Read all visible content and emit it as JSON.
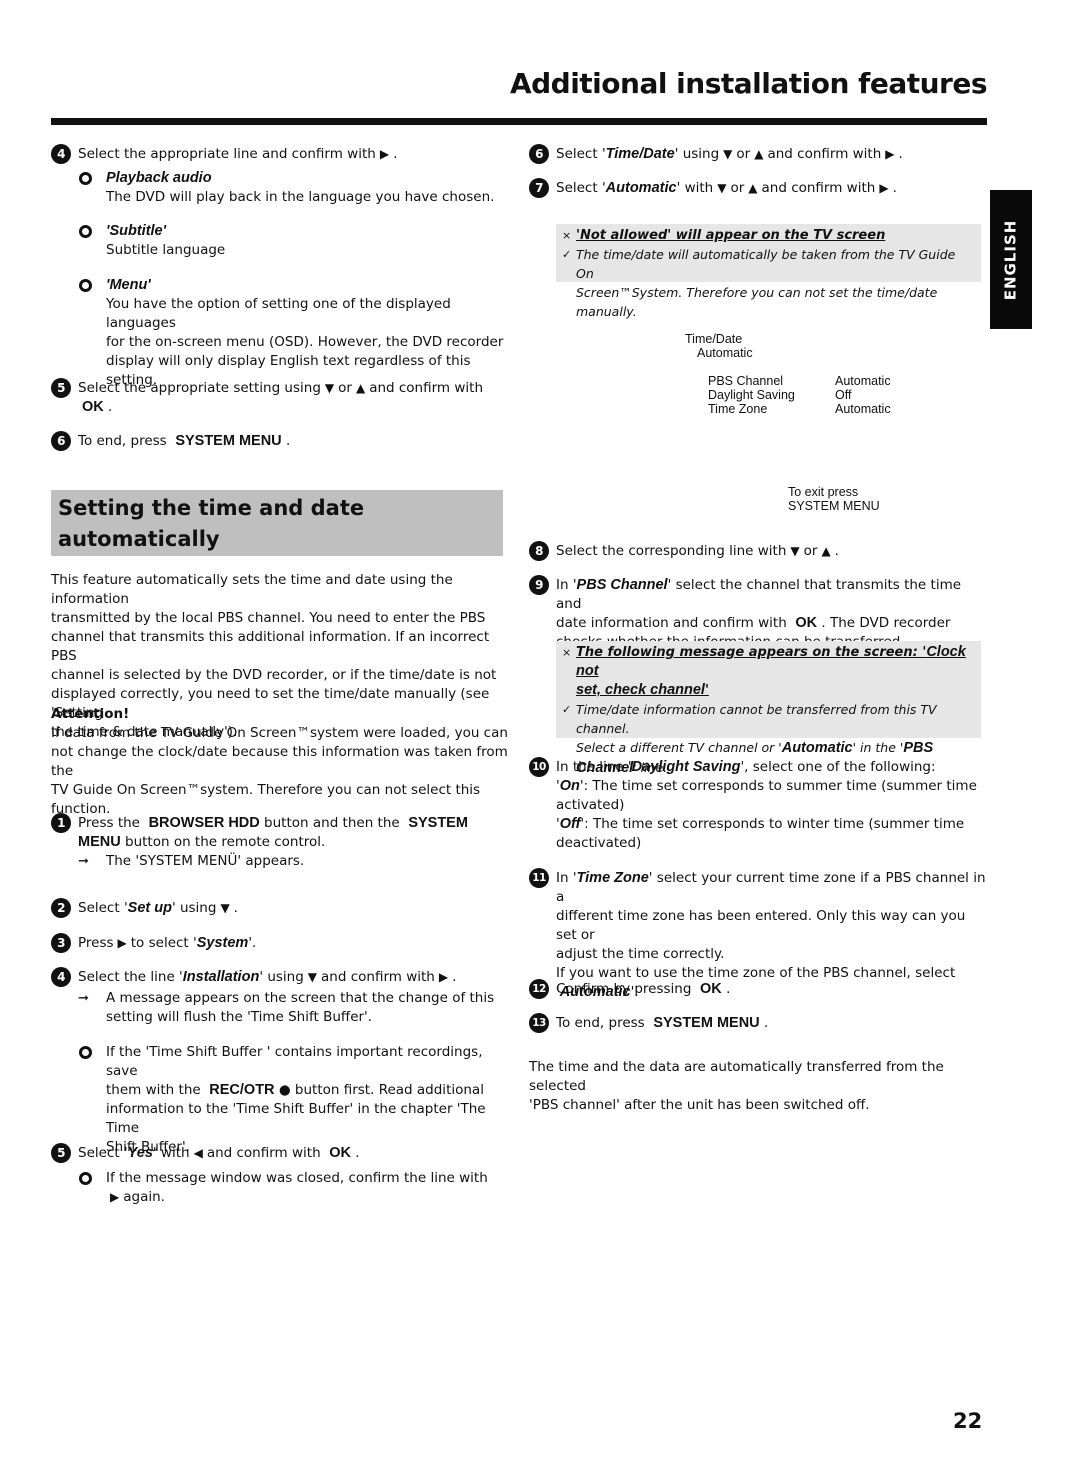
{
  "header": {
    "title": "Additional installation features",
    "language_tab": "ENGLISH",
    "page_number": "22"
  },
  "left_column": {
    "step4_top": {
      "number": "4",
      "text": "Select the appropriate line and confirm with",
      "end": ".",
      "options": [
        {
          "label": "Playback audio",
          "desc": "The DVD will play back in the language you have chosen."
        },
        {
          "label": "'Subtitle'",
          "desc": "Subtitle language"
        },
        {
          "label": "'Menu'",
          "desc_lines": [
            "You have the option of setting one of the displayed languages",
            "for the on-screen menu (OSD). However, the DVD recorder",
            "display will only display English text regardless of this setting."
          ]
        }
      ]
    },
    "step5_top": {
      "number": "5",
      "text_a": "Select the appropriate setting using",
      "or": "or",
      "text_b": "and confirm with",
      "key": "OK",
      "end": "."
    },
    "step6_top": {
      "number": "6",
      "text": "To end, press",
      "key": "SYSTEM MENU",
      "end": "."
    },
    "section_title_lines": [
      "Setting the time and date",
      "automatically"
    ],
    "intro_lines": [
      "This feature automatically sets the time and date using the information",
      "transmitted by the local PBS channel. You need to enter the PBS",
      "channel that transmits this additional information. If an incorrect PBS",
      "channel is selected by the DVD recorder, or if the time/date is not",
      "displayed correctly, you need to set the time/date manually (see 'Setting",
      "the time & date manually')."
    ],
    "attention_label": "Attention!",
    "attention_lines": [
      "If data from the TV Guide On Screen™system were loaded, you can",
      "not change the clock/date because this information was taken from the",
      "TV Guide On Screen™system. Therefore you can not select this",
      "function."
    ],
    "step1": {
      "number": "1",
      "a": "Press the",
      "key1": "BROWSER HDD",
      "b": "button and then the",
      "key2a": "SYSTEM",
      "key2b": "MENU",
      "c": "button on the remote control.",
      "result": "The 'SYSTEM MENÜ' appears."
    },
    "step2": {
      "number": "2",
      "a": "Select '",
      "key": "Set up",
      "b": "' using",
      "end": "."
    },
    "step3": {
      "number": "3",
      "a": "Press",
      "b": "to select '",
      "key": "System",
      "end": "'."
    },
    "step4": {
      "number": "4",
      "a": "Select the line '",
      "key": "Installation",
      "b": "' using",
      "c": "and confirm with",
      "end": ".",
      "result_lines": [
        "A message appears on the screen that the change of this",
        "setting will flush the 'Time Shift Buffer'."
      ],
      "note_a": "If the 'Time Shift Buffer ' contains important recordings, save",
      "note_b1": "them with the",
      "note_key": "REC/OTR",
      "note_b2": "button first. Read additional",
      "note_c": "information to the 'Time Shift Buffer' in the chapter 'The Time",
      "note_d": "Shift Buffer'."
    },
    "step5": {
      "number": "5",
      "a": "Select '",
      "key": "Yes",
      "b": "' with",
      "c": "and confirm with",
      "key2": "OK",
      "end": ".",
      "note_a": "If the message window was closed, confirm the line with",
      "note_b": "again."
    }
  },
  "right_column": {
    "step6": {
      "number": "6",
      "a": "Select '",
      "key": "Time/Date",
      "b": "' using",
      "or": "or",
      "c": "and confirm with",
      "end": "."
    },
    "step7": {
      "number": "7",
      "a": "Select '",
      "key": "Automatic",
      "b": "' with",
      "or": "or",
      "c": "and confirm with",
      "end": "."
    },
    "note1": {
      "problem": "'Not allowed' will appear on the TV screen",
      "solution_lines": [
        "The time/date will automatically be taken from the TV Guide On",
        "Screen™System. Therefore you can not set the time/date manually."
      ]
    },
    "osd": {
      "title": "Time/Date",
      "subtitle": "Automatic",
      "rows": [
        {
          "key": "PBS Channel",
          "value": "Automatic"
        },
        {
          "key": "Daylight Saving",
          "value": "Off"
        },
        {
          "key": "Time Zone",
          "value": "Automatic"
        }
      ],
      "exit_line1": "To exit press",
      "exit_line2": "SYSTEM MENU"
    },
    "step8": {
      "number": "8",
      "a": "Select the corresponding line with",
      "or": "or",
      "end": "."
    },
    "step9": {
      "number": "9",
      "a": "In '",
      "key": "PBS Channel",
      "b": "' select the channel that transmits the time and",
      "c": "date information and confirm with",
      "key2": "OK",
      "d": ". The DVD recorder",
      "e": "checks whether the information can be transferred."
    },
    "note2": {
      "problem_a": "The following message appears on the screen: '",
      "problem_key": "Clock not",
      "problem_b": "set, check channel",
      "problem_end": "'",
      "solution_a": "Time/date information cannot be transferred from this TV channel.",
      "solution_b": "Select a different TV channel or '",
      "solution_key1": "Automatic",
      "solution_c": "' in the '",
      "solution_key2a": "PBS",
      "solution_key2b": "Channel",
      "solution_d": "' line."
    },
    "step10": {
      "number": "10",
      "a": "In the line '",
      "key": "Daylight Saving",
      "b": "', select one of the following:",
      "on_key": "On",
      "on_a": "': The time set corresponds to summer time (summer time",
      "on_b": "activated)",
      "off_key": "Off",
      "off_a": "': The time set corresponds to winter time (summer time",
      "off_b": "deactivated)"
    },
    "step11": {
      "number": "11",
      "a": "In '",
      "key": "Time Zone",
      "b": "' select your current time zone if a PBS channel in a",
      "c": "different time zone has been entered. Only this way can you set or",
      "d": "adjust the time correctly.",
      "e": "If you want to use the time zone of the PBS channel, select",
      "f_key": "Automatic",
      "f_end": "'."
    },
    "step12": {
      "number": "12",
      "a": "Confirm by pressing",
      "key": "OK",
      "end": "."
    },
    "step13": {
      "number": "13",
      "a": "To end, press",
      "key": "SYSTEM MENU",
      "end": "."
    },
    "closing_lines": [
      "The time and the data are automatically transferred from the selected",
      "'PBS channel' after the unit has been switched off."
    ]
  }
}
